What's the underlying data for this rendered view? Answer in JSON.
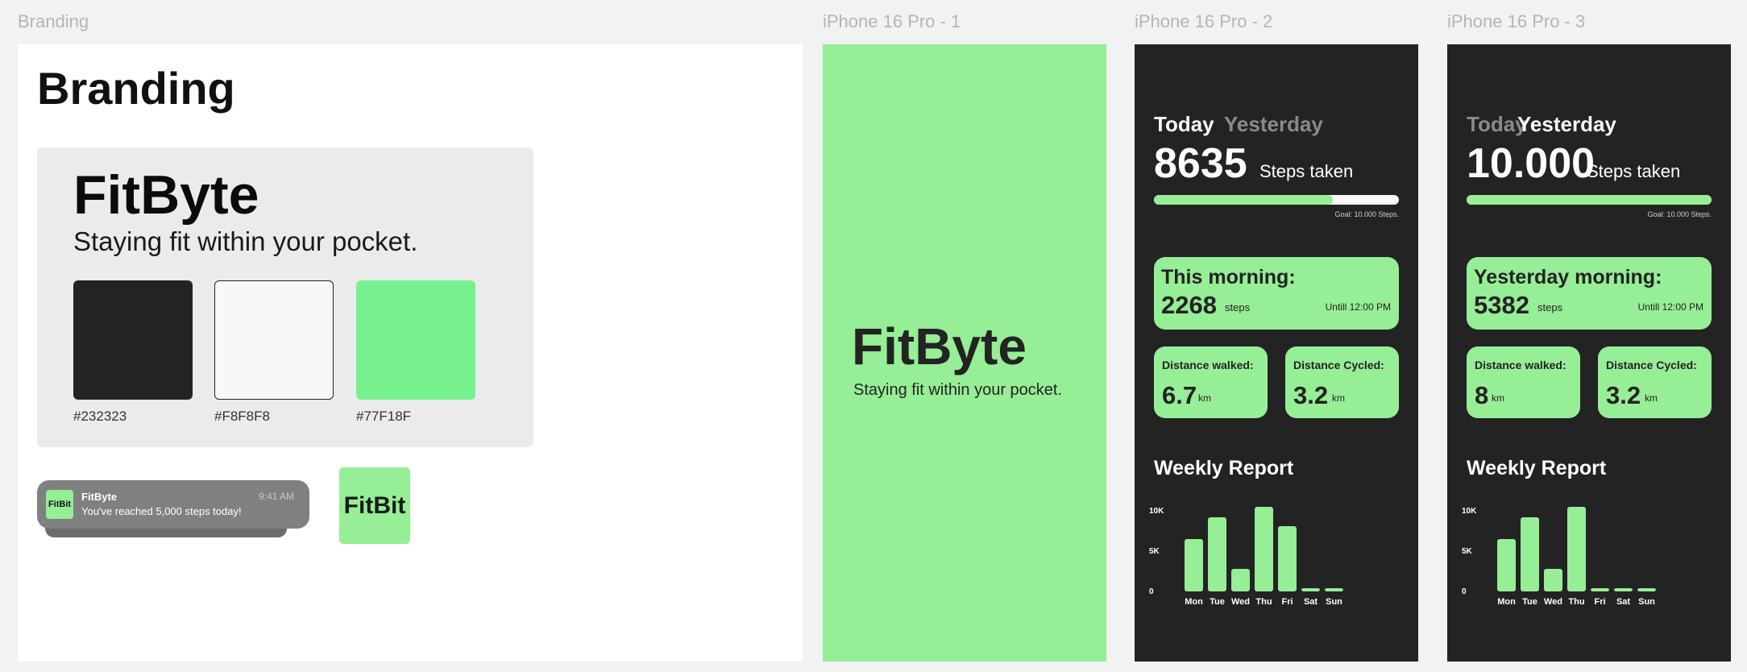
{
  "frames": {
    "branding": "Branding",
    "phone1": "iPhone 16 Pro - 1",
    "phone2": "iPhone 16 Pro - 2",
    "phone3": "iPhone 16 Pro - 3"
  },
  "branding": {
    "title": "Branding",
    "brand_name": "FitByte",
    "tagline": "Staying fit within your pocket.",
    "swatches": [
      {
        "color": "#232323",
        "label": "#232323"
      },
      {
        "color": "#F8F8F8",
        "label": "#F8F8F8"
      },
      {
        "color": "#77F18F",
        "label": "#77F18F"
      }
    ],
    "notification": {
      "icon_text": "FitBit",
      "app": "FitByte",
      "time": "9:41 AM",
      "message": "You've reached 5,000 steps today!"
    },
    "app_icon_text": "FitBit"
  },
  "splash": {
    "brand_name": "FitByte",
    "tagline": "Staying fit within your pocket."
  },
  "today_screen": {
    "tab_today": "Today",
    "tab_yesterday": "Yesterday",
    "active_tab": "today",
    "steps": "8635",
    "steps_label": "Steps taken",
    "progress": 0.73,
    "goal": "Goal: 10.000 Steps.",
    "morning_title": "This morning:",
    "morning_steps": "2268",
    "morning_unit": "steps",
    "until": "Untill 12:00 PM",
    "walked_title": "Distance walked:",
    "walked_value": "6.7",
    "walked_unit": "km",
    "cycled_title": "Distance Cycled:",
    "cycled_value": "3.2",
    "cycled_unit": "km",
    "weekly_title": "Weekly Report"
  },
  "yesterday_screen": {
    "tab_today": "Today",
    "tab_yesterday": "Yesterday",
    "active_tab": "yesterday",
    "steps": "10.000",
    "steps_label": "Steps taken",
    "progress": 1.0,
    "goal": "Goal: 10.000 Steps.",
    "morning_title": "Yesterday morning:",
    "morning_steps": "5382",
    "morning_unit": "steps",
    "until": "Untill 12:00 PM",
    "walked_title": "Distance walked:",
    "walked_value": "8",
    "walked_unit": "km",
    "cycled_title": "Distance Cycled:",
    "cycled_value": "3.2",
    "cycled_unit": "km",
    "weekly_title": "Weekly Report"
  },
  "colors": {
    "dark": "#232323",
    "light": "#F8F8F8",
    "accent": "#96ee96",
    "muted_tab": "#8a8a8a"
  },
  "chart_data": [
    {
      "type": "bar",
      "categories": [
        "Mon",
        "Tue",
        "Wed",
        "Thu",
        "Fri",
        "Sat",
        "Sun"
      ],
      "values": [
        6500,
        9200,
        2800,
        10500,
        8100,
        300,
        300
      ],
      "ylim": [
        0,
        10000
      ],
      "ytick_labels": [
        "0",
        "5K",
        "10K"
      ],
      "yticks": [
        0,
        5000,
        10000
      ]
    },
    {
      "type": "bar",
      "categories": [
        "Mon",
        "Tue",
        "Wed",
        "Thu",
        "Fri",
        "Sat",
        "Sun"
      ],
      "values": [
        6500,
        9200,
        2800,
        10500,
        300,
        300,
        300
      ],
      "ylim": [
        0,
        10000
      ],
      "ytick_labels": [
        "0",
        "5K",
        "10K"
      ],
      "yticks": [
        0,
        5000,
        10000
      ]
    }
  ]
}
